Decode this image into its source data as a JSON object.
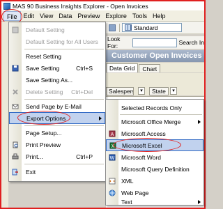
{
  "window": {
    "title": "MAS 90 Business Insights Explorer - Open Invoices"
  },
  "menubar": {
    "items": [
      "File",
      "Edit",
      "View",
      "Data",
      "Preview",
      "Explore",
      "Tools",
      "Help"
    ]
  },
  "toolbar": {
    "layout_value": "Standard"
  },
  "lookfor": {
    "label": "Look For:",
    "search_label": "Search In"
  },
  "view": {
    "title": "Customer Open Invoices",
    "tabs": [
      "Data Grid",
      "Chart"
    ],
    "filters": [
      "Salesperson",
      "State"
    ]
  },
  "file_menu": {
    "items": [
      {
        "label": "Default Setting",
        "shortcut": "",
        "disabled": true,
        "icon": "save-default-icon"
      },
      {
        "label": "Default Setting for All Users",
        "shortcut": "",
        "disabled": true,
        "icon": ""
      },
      {
        "label": "Reset Setting",
        "shortcut": "",
        "disabled": false,
        "icon": ""
      },
      {
        "label": "Save Setting",
        "shortcut": "Ctrl+S",
        "disabled": false,
        "icon": "save-icon"
      },
      {
        "label": "Save Setting As...",
        "shortcut": "",
        "disabled": false,
        "icon": ""
      },
      {
        "label": "Delete Setting",
        "shortcut": "Ctrl+Del",
        "disabled": true,
        "icon": "delete-icon"
      },
      {
        "label": "Send Page by E-Mail",
        "shortcut": "",
        "disabled": false,
        "icon": "email-icon"
      },
      {
        "label": "Export Options",
        "shortcut": "",
        "disabled": false,
        "icon": ""
      },
      {
        "label": "Page Setup...",
        "shortcut": "",
        "disabled": false,
        "icon": ""
      },
      {
        "label": "Print Preview",
        "shortcut": "",
        "disabled": false,
        "icon": "print-preview-icon"
      },
      {
        "label": "Print...",
        "shortcut": "Ctrl+P",
        "disabled": false,
        "icon": "print-icon"
      },
      {
        "label": "Exit",
        "shortcut": "",
        "disabled": false,
        "icon": "exit-icon"
      }
    ]
  },
  "export_menu": {
    "items": [
      {
        "label": "Selected Records Only",
        "icon": ""
      },
      {
        "label": "Microsoft Office Merge",
        "icon": "",
        "submenu": true
      },
      {
        "label": "Microsoft Access",
        "icon": "access-icon"
      },
      {
        "label": "Microsoft Excel",
        "icon": "excel-icon"
      },
      {
        "label": "Microsoft Word",
        "icon": "word-icon"
      },
      {
        "label": "Microsoft Query Definition",
        "icon": ""
      },
      {
        "label": "XML",
        "icon": "xml-icon"
      },
      {
        "label": "Web Page",
        "icon": "web-page-icon"
      },
      {
        "label": "Text",
        "icon": "",
        "submenu": true
      }
    ]
  },
  "colors": {
    "highlight": "#c1d2ee",
    "highlight_border": "#316ac5",
    "annotation": "#e02020"
  }
}
